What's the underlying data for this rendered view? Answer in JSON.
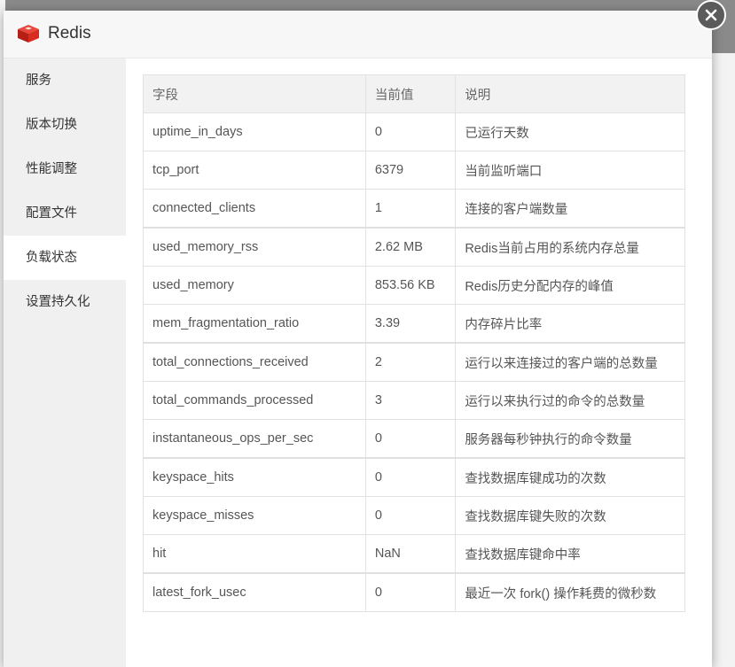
{
  "dialog": {
    "title": "Redis",
    "close_icon": "close-icon",
    "logo_icon": "redis-cube-icon",
    "brand_color": "#d82c20"
  },
  "sidebar": {
    "items": [
      {
        "label": "服务"
      },
      {
        "label": "版本切换"
      },
      {
        "label": "性能调整"
      },
      {
        "label": "配置文件"
      },
      {
        "label": "负载状态",
        "active": true
      },
      {
        "label": "设置持久化"
      }
    ]
  },
  "table": {
    "headers": [
      "字段",
      "当前值",
      "说明"
    ],
    "rows": [
      {
        "field": "uptime_in_days",
        "value": "0",
        "desc": "已运行天数"
      },
      {
        "field": "tcp_port",
        "value": "6379",
        "desc": "当前监听端口"
      },
      {
        "field": "connected_clients",
        "value": "1",
        "desc": "连接的客户端数量"
      },
      {
        "field": "used_memory_rss",
        "value": "2.62 MB",
        "desc": "Redis当前占用的系统内存总量"
      },
      {
        "field": "used_memory",
        "value": "853.56 KB",
        "desc": "Redis历史分配内存的峰值"
      },
      {
        "field": "mem_fragmentation_ratio",
        "value": "3.39",
        "desc": "内存碎片比率"
      },
      {
        "field": "total_connections_received",
        "value": "2",
        "desc": "运行以来连接过的客户端的总数量"
      },
      {
        "field": "total_commands_processed",
        "value": "3",
        "desc": "运行以来执行过的命令的总数量"
      },
      {
        "field": "instantaneous_ops_per_sec",
        "value": "0",
        "desc": "服务器每秒钟执行的命令数量"
      },
      {
        "field": "keyspace_hits",
        "value": "0",
        "desc": "查找数据库键成功的次数"
      },
      {
        "field": "keyspace_misses",
        "value": "0",
        "desc": "查找数据库键失败的次数"
      },
      {
        "field": "hit",
        "value": "NaN",
        "desc": "查找数据库键命中率"
      },
      {
        "field": "latest_fork_usec",
        "value": "0",
        "desc": "最近一次 fork() 操作耗费的微秒数"
      }
    ]
  }
}
